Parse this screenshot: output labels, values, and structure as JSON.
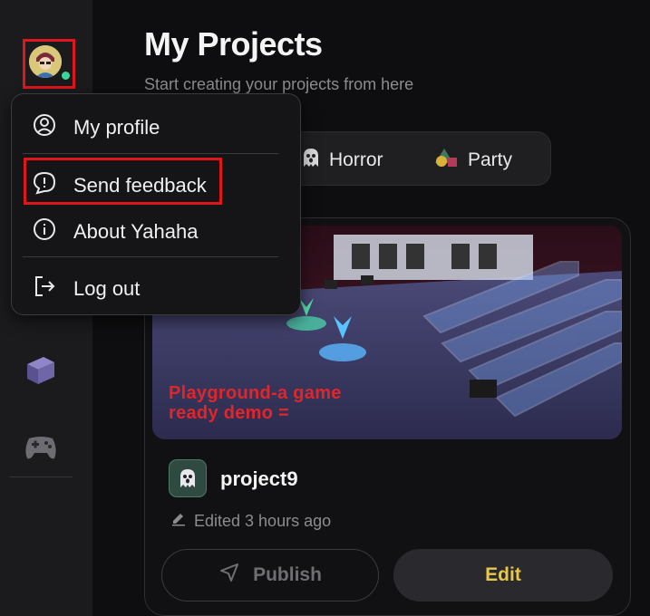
{
  "page": {
    "title": "My Projects",
    "subtitle": "Start creating your projects from here"
  },
  "tags": [
    {
      "label": "Horror",
      "icon": "ghost-icon"
    },
    {
      "label": "Party",
      "icon": "party-shapes-icon"
    }
  ],
  "sidebar": {
    "status": "online",
    "icons": [
      "book-icon",
      "gamepad-icon"
    ]
  },
  "menu": {
    "items": [
      {
        "label": "My profile",
        "icon": "user-circle-icon"
      },
      {
        "label": "Send feedback",
        "icon": "alert-bubble-icon",
        "highlighted": true
      },
      {
        "label": "About Yahaha",
        "icon": "info-icon"
      },
      {
        "label": "Log out",
        "icon": "logout-icon"
      }
    ]
  },
  "project": {
    "name": "project9",
    "edited": "Edited 3 hours ago",
    "thumbnail_caption_line1": "Playground-a game",
    "thumbnail_caption_line2": "ready demo =",
    "publish_label": "Publish",
    "edit_label": "Edit"
  },
  "colors": {
    "highlight": "#e0161c",
    "edit_text": "#e6c84a",
    "status_dot": "#3bd49a",
    "background": "#0e0e10"
  }
}
